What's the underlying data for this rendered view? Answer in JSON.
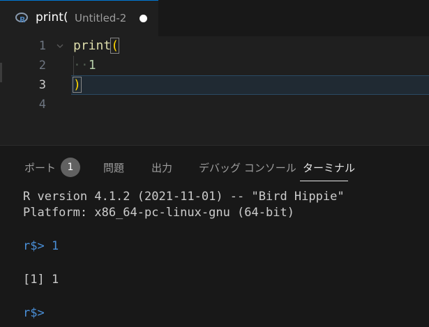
{
  "tab": {
    "title": "print(",
    "description": "Untitled-2",
    "icon": "r-language-icon",
    "modified": true
  },
  "editor": {
    "lines": [
      {
        "number": "1",
        "text": "print("
      },
      {
        "number": "2",
        "whitespace": "··",
        "text": "1"
      },
      {
        "number": "3",
        "text": ")"
      },
      {
        "number": "4",
        "text": ""
      }
    ]
  },
  "panel": {
    "tabs": [
      {
        "label": "ポート",
        "badge": "1"
      },
      {
        "label": "問題"
      },
      {
        "label": "出力"
      },
      {
        "label": "デバッグ コンソール"
      },
      {
        "label": "ターミナル",
        "active": true
      }
    ],
    "terminal": {
      "version_line": "R version 4.1.2 (2021-11-01) -- \"Bird Hippie\"",
      "platform_line": "Platform: x86_64-pc-linux-gnu (64-bit)",
      "prompt": "r$>",
      "input": " 1",
      "output": "[1] 1",
      "prompt2": "r$>"
    }
  },
  "colors": {
    "accent": "#0078d4",
    "function": "#dcdcaa",
    "number": "#b5cea8",
    "bracket": "#ffd700",
    "prompt": "#4a90d9"
  }
}
